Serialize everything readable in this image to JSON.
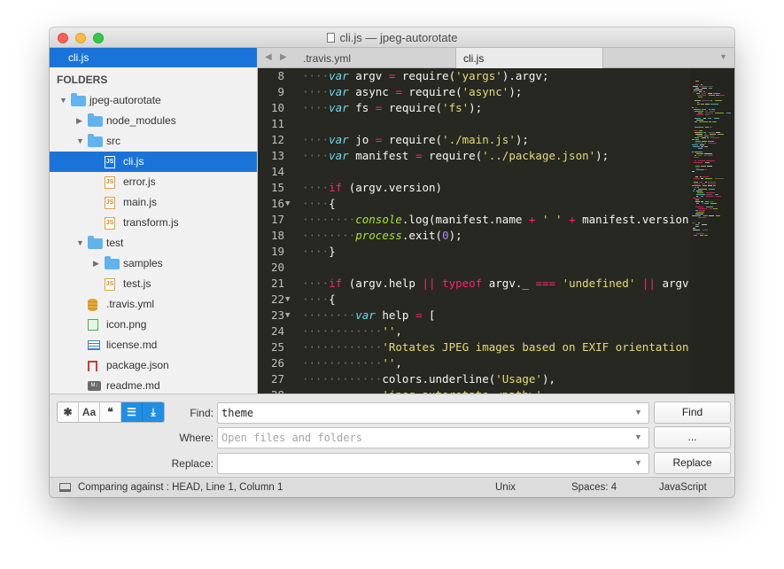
{
  "window": {
    "title": "cli.js — jpeg-autorotate"
  },
  "sidebar": {
    "open_file": "cli.js",
    "folders_label": "FOLDERS",
    "tree": [
      {
        "label": "jpeg-autorotate",
        "kind": "folder",
        "expanded": true,
        "depth": 0
      },
      {
        "label": "node_modules",
        "kind": "folder",
        "expanded": false,
        "depth": 1
      },
      {
        "label": "src",
        "kind": "folder",
        "expanded": true,
        "depth": 1
      },
      {
        "label": "cli.js",
        "kind": "js",
        "depth": 2,
        "selected": true
      },
      {
        "label": "error.js",
        "kind": "js",
        "depth": 2
      },
      {
        "label": "main.js",
        "kind": "js",
        "depth": 2
      },
      {
        "label": "transform.js",
        "kind": "js",
        "depth": 2
      },
      {
        "label": "test",
        "kind": "folder",
        "expanded": true,
        "depth": 1
      },
      {
        "label": "samples",
        "kind": "folder",
        "expanded": false,
        "depth": 2
      },
      {
        "label": "test.js",
        "kind": "js",
        "depth": 2
      },
      {
        "label": ".travis.yml",
        "kind": "yml",
        "depth": 1
      },
      {
        "label": "icon.png",
        "kind": "png",
        "depth": 1
      },
      {
        "label": "license.md",
        "kind": "md",
        "depth": 1
      },
      {
        "label": "package.json",
        "kind": "pkg",
        "depth": 1
      },
      {
        "label": "readme.md",
        "kind": "mdown",
        "depth": 1
      }
    ]
  },
  "tabs": [
    {
      "label": ".travis.yml",
      "active": false
    },
    {
      "label": "cli.js",
      "active": true
    }
  ],
  "editor": {
    "lines": [
      {
        "n": "8",
        "fold": "",
        "html": "<span class=\"ws\">····</span><span class=\"kw\">var</span> argv <span class=\"op\">=</span> require(<span class=\"str\">'yargs'</span>).argv;"
      },
      {
        "n": "9",
        "fold": "",
        "html": "<span class=\"ws\">····</span><span class=\"kw\">var</span> async <span class=\"op\">=</span> require(<span class=\"str\">'async'</span>);"
      },
      {
        "n": "10",
        "fold": "",
        "html": "<span class=\"ws\">····</span><span class=\"kw\">var</span> fs <span class=\"op\">=</span> require(<span class=\"str\">'fs'</span>);"
      },
      {
        "n": "11",
        "fold": "",
        "html": ""
      },
      {
        "n": "12",
        "fold": "",
        "html": "<span class=\"ws\">····</span><span class=\"kw\">var</span> jo <span class=\"op\">=</span> require(<span class=\"str\">'./main.js'</span>);"
      },
      {
        "n": "13",
        "fold": "",
        "html": "<span class=\"ws\">····</span><span class=\"kw\">var</span> manifest <span class=\"op\">=</span> require(<span class=\"str\">'../package.json'</span>);"
      },
      {
        "n": "14",
        "fold": "",
        "html": ""
      },
      {
        "n": "15",
        "fold": "",
        "html": "<span class=\"ws\">····</span><span class=\"kw2\">if</span> (argv.version)"
      },
      {
        "n": "16",
        "fold": "▼",
        "html": "<span class=\"ws\">····</span>{"
      },
      {
        "n": "17",
        "fold": "",
        "html": "<span class=\"ws\">········</span><span class=\"fn\">console</span>.log(manifest.name <span class=\"op\">+</span> <span class=\"str\">' '</span> <span class=\"op\">+</span> manifest.version);"
      },
      {
        "n": "18",
        "fold": "",
        "html": "<span class=\"ws\">········</span><span class=\"fn\">process</span>.exit(<span class=\"num\">0</span>);"
      },
      {
        "n": "19",
        "fold": "",
        "html": "<span class=\"ws\">····</span>}"
      },
      {
        "n": "20",
        "fold": "",
        "html": ""
      },
      {
        "n": "21",
        "fold": "",
        "html": "<span class=\"ws\">····</span><span class=\"kw2\">if</span> (argv.help <span class=\"op\">||</span> <span class=\"kw2\">typeof</span> argv._ <span class=\"op\">===</span> <span class=\"str\">'undefined'</span> <span class=\"op\">||</span> argv._.le"
      },
      {
        "n": "22",
        "fold": "▼",
        "html": "<span class=\"ws\">····</span>{"
      },
      {
        "n": "23",
        "fold": "▼",
        "html": "<span class=\"ws\">········</span><span class=\"kw\">var</span> help <span class=\"op\">=</span> ["
      },
      {
        "n": "24",
        "fold": "",
        "html": "<span class=\"ws\">············</span><span class=\"str\">''</span>,"
      },
      {
        "n": "25",
        "fold": "",
        "html": "<span class=\"ws\">············</span><span class=\"str\">'Rotates JPEG images based on EXIF orientation'</span>,"
      },
      {
        "n": "26",
        "fold": "",
        "html": "<span class=\"ws\">············</span><span class=\"str\">''</span>,"
      },
      {
        "n": "27",
        "fold": "",
        "html": "<span class=\"ws\">············</span>colors.underline(<span class=\"str\">'Usage'</span>),"
      },
      {
        "n": "28",
        "fold": "",
        "html": "<span class=\"ws\">············</span><span class=\"str\">'jpeg-autorotate &lt;path&gt;'</span>,"
      }
    ]
  },
  "find": {
    "options": [
      {
        "glyph": "✱",
        "name": "regex-toggle",
        "on": false
      },
      {
        "glyph": "Aa",
        "name": "case-sensitive-toggle",
        "on": false
      },
      {
        "glyph": "❝",
        "name": "whole-word-toggle",
        "on": false
      },
      {
        "glyph": "☰",
        "name": "show-context-toggle",
        "on": true
      },
      {
        "glyph": "⤓",
        "name": "use-buffer-toggle",
        "on": true
      }
    ],
    "find_label": "Find:",
    "find_value": "theme",
    "where_label": "Where:",
    "where_placeholder": "Open files and folders",
    "replace_label": "Replace:",
    "replace_value": "",
    "find_button": "Find",
    "where_button": "...",
    "replace_button": "Replace"
  },
  "status": {
    "message": "Comparing against : HEAD, Line 1, Column 1",
    "line_endings": "Unix",
    "indentation": "Spaces: 4",
    "syntax": "JavaScript"
  },
  "colors": {
    "accent": "#1a73d9",
    "editor_bg": "#272822"
  }
}
